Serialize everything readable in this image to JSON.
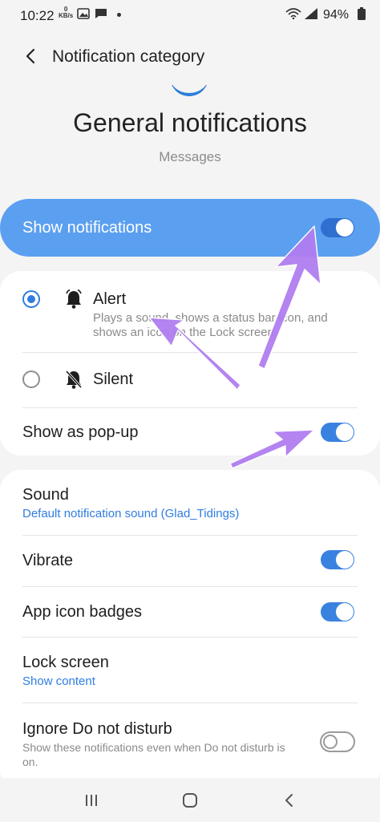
{
  "status_bar": {
    "time": "10:22",
    "net_speed_top": "0",
    "net_speed_unit": "KB/s",
    "battery": "94%"
  },
  "header": {
    "title": "Notification category"
  },
  "category": {
    "title": "General notifications",
    "app": "Messages"
  },
  "show_notifications": {
    "label": "Show notifications",
    "enabled": true
  },
  "alert_options": {
    "alert": {
      "label": "Alert",
      "desc_line1": "Plays a sound, shows a status bar icon, and",
      "desc_line2": "shows an icon on the Lock screen.",
      "selected": true
    },
    "silent": {
      "label": "Silent",
      "selected": false
    },
    "popup": {
      "label": "Show as pop-up",
      "enabled": true
    }
  },
  "settings": {
    "sound": {
      "label": "Sound",
      "value": "Default notification sound (Glad_Tidings)"
    },
    "vibrate": {
      "label": "Vibrate",
      "enabled": true
    },
    "badges": {
      "label": "App icon badges",
      "enabled": true
    },
    "lock_screen": {
      "label": "Lock screen",
      "value": "Show content"
    },
    "dnd": {
      "label": "Ignore Do not disturb",
      "desc_line1": "Show these notifications even when Do not disturb is",
      "desc_line2": "on.",
      "enabled": false
    }
  },
  "colors": {
    "accent": "#2f7de0",
    "show_bar": "#5b9ff0",
    "annotation_arrow": "#b07ef0"
  },
  "icons": [
    "wifi-icon",
    "signal-icon",
    "image-icon",
    "message-icon",
    "back-arrow-icon",
    "bell-icon",
    "bell-off-icon",
    "recents-icon",
    "home-icon",
    "nav-back-icon"
  ]
}
